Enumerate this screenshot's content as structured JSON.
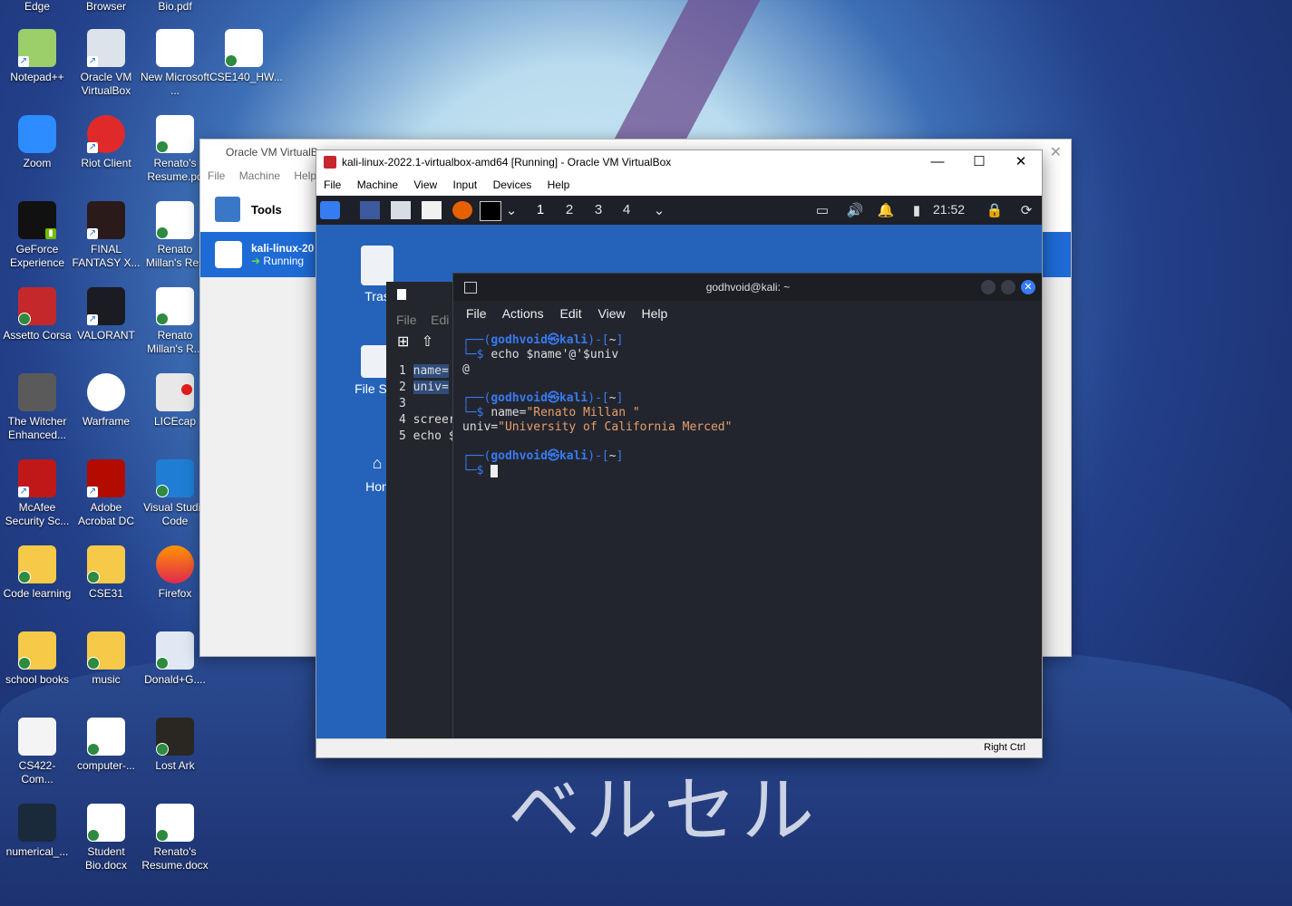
{
  "top_labels": [
    "Edge",
    "Browser",
    "Bio.pdf"
  ],
  "desktop_icons": [
    {
      "label": "Notepad++"
    },
    {
      "label": "Oracle VM VirtualBox"
    },
    {
      "label": "New Microsoft ..."
    },
    {
      "label": "CSE140_HW..."
    },
    {
      "label": "Zoom"
    },
    {
      "label": "Riot Client"
    },
    {
      "label": "Renato's Resume.pd"
    },
    {
      "label": "GeForce Experience"
    },
    {
      "label": "FINAL FANTASY X..."
    },
    {
      "label": "Renato Millan's Res"
    },
    {
      "label": "Assetto Corsa"
    },
    {
      "label": "VALORANT"
    },
    {
      "label": "Renato Millan's R..."
    },
    {
      "label": "The Witcher Enhanced..."
    },
    {
      "label": "Warframe"
    },
    {
      "label": "LICEcap"
    },
    {
      "label": "McAfee Security Sc..."
    },
    {
      "label": "Adobe Acrobat DC"
    },
    {
      "label": "Visual Studio Code"
    },
    {
      "label": "Code learning"
    },
    {
      "label": "CSE31"
    },
    {
      "label": "Firefox"
    },
    {
      "label": "school books"
    },
    {
      "label": "music"
    },
    {
      "label": "Donald+G...."
    },
    {
      "label": "CS422-Com..."
    },
    {
      "label": "computer-..."
    },
    {
      "label": "Lost Ark"
    },
    {
      "label": "numerical_..."
    },
    {
      "label": "Student Bio.docx"
    },
    {
      "label": "Renato's Resume.docx"
    }
  ],
  "vbox_manager": {
    "title": "Oracle VM VirtualB",
    "menu": [
      "File",
      "Machine",
      "Help"
    ],
    "tools_label": "Tools",
    "vm_name": "kali-linux-20",
    "vm_state": "Running"
  },
  "vm_window": {
    "title": "kali-linux-2022.1-virtualbox-amd64 [Running] - Oracle VM VirtualBox",
    "menu": [
      "File",
      "Machine",
      "View",
      "Input",
      "Devices",
      "Help"
    ],
    "status_right": "Right Ctrl"
  },
  "guest": {
    "workspaces": [
      "1",
      "2",
      "3",
      "4"
    ],
    "clock": "21:52",
    "desktop_icons": [
      "Tras",
      "File Sys",
      "Hon"
    ],
    "editor_menu": [
      "File",
      "Edi"
    ],
    "editor_lines": [
      {
        "num": "1",
        "text": "name="
      },
      {
        "num": "2",
        "text": "univ="
      },
      {
        "num": "3",
        "text": ""
      },
      {
        "num": "4",
        "text": "screer"
      },
      {
        "num": "5",
        "text": "echo $"
      }
    ]
  },
  "terminal": {
    "title": "godhvoid@kali: ~",
    "menu": [
      "File",
      "Actions",
      "Edit",
      "View",
      "Help"
    ],
    "user": "godhvoid",
    "host": "kali",
    "dir": "~",
    "cmd1": "echo $name'@'$univ",
    "out1": "@",
    "cmd2_prefix": "name=",
    "cmd2_str": "\"Renato Millan \"",
    "cmd3_prefix": "univ=",
    "cmd3_str": "\"University of California Merced\""
  }
}
